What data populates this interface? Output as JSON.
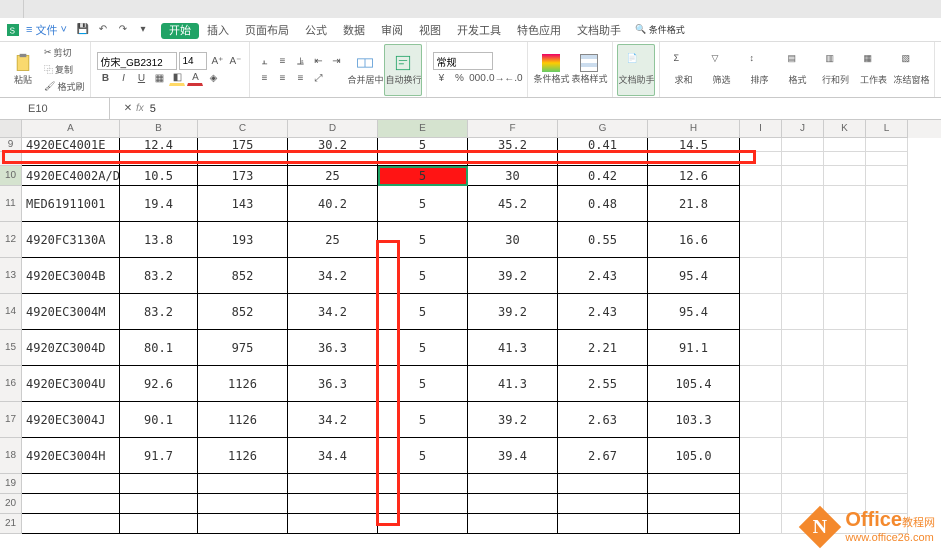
{
  "menu": {
    "file": "文件",
    "tabs": [
      "开始",
      "插入",
      "页面布局",
      "公式",
      "数据",
      "审阅",
      "视图",
      "开发工具",
      "特色应用",
      "文档助手"
    ],
    "active_index": 0,
    "cond_fmt_hint": "条件格式"
  },
  "ribbon": {
    "cut": "剪切",
    "copy": "复制",
    "fmtpaint": "格式刷",
    "paste": "粘贴",
    "font_name": "仿宋_GB2312",
    "font_size": "14",
    "merge": "合并居中",
    "autowrap": "自动换行",
    "num_fmt": "常规",
    "cond_fmt": "条件格式",
    "tbl_style": "表格样式",
    "doc_helper": "文档助手",
    "sum": "求和",
    "filter": "筛选",
    "sort": "排序",
    "format": "格式",
    "rowcol": "行和列",
    "sheet": "工作表",
    "freeze": "冻结窗格"
  },
  "name_box": "E10",
  "formula": {
    "fx": "fx",
    "value": "5"
  },
  "columns": [
    "A",
    "B",
    "C",
    "D",
    "E",
    "F",
    "G",
    "H",
    "I",
    "J",
    "K",
    "L"
  ],
  "sel_col_index": 4,
  "rows_data": [
    {
      "n": "9",
      "h": "short",
      "d": [
        "4920EC4001E",
        "12.4",
        "175",
        "30.2",
        "5",
        "35.2",
        "0.41",
        "14.5"
      ]
    },
    {
      "n": "",
      "h": "short",
      "d": [
        "",
        "",
        "",
        "",
        "",
        "",
        "",
        ""
      ]
    },
    {
      "n": "10",
      "h": "med",
      "d": [
        "4920EC4002A/D",
        "10.5",
        "173",
        "25",
        "5",
        "30",
        "0.42",
        "12.6"
      ],
      "sel": true
    },
    {
      "n": "11",
      "h": "",
      "d": [
        "MED61911001",
        "19.4",
        "143",
        "40.2",
        "5",
        "45.2",
        "0.48",
        "21.8"
      ]
    },
    {
      "n": "12",
      "h": "",
      "d": [
        "4920FC3130A",
        "13.8",
        "193",
        "25",
        "5",
        "30",
        "0.55",
        "16.6"
      ]
    },
    {
      "n": "13",
      "h": "",
      "d": [
        "4920EC3004B",
        "83.2",
        "852",
        "34.2",
        "5",
        "39.2",
        "2.43",
        "95.4"
      ]
    },
    {
      "n": "14",
      "h": "",
      "d": [
        "4920EC3004M",
        "83.2",
        "852",
        "34.2",
        "5",
        "39.2",
        "2.43",
        "95.4"
      ]
    },
    {
      "n": "15",
      "h": "",
      "d": [
        "4920ZC3004D",
        "80.1",
        "975",
        "36.3",
        "5",
        "41.3",
        "2.21",
        "91.1"
      ]
    },
    {
      "n": "16",
      "h": "",
      "d": [
        "4920EC3004U",
        "92.6",
        "1126",
        "36.3",
        "5",
        "41.3",
        "2.55",
        "105.4"
      ]
    },
    {
      "n": "17",
      "h": "",
      "d": [
        "4920EC3004J",
        "90.1",
        "1126",
        "34.2",
        "5",
        "39.2",
        "2.63",
        "103.3"
      ]
    },
    {
      "n": "18",
      "h": "",
      "d": [
        "4920EC3004H",
        "91.7",
        "1126",
        "34.4",
        "5",
        "39.4",
        "2.67",
        "105.0"
      ]
    },
    {
      "n": "19",
      "h": "med",
      "d": [
        "",
        "",
        "",
        "",
        "",
        "",
        "",
        ""
      ]
    },
    {
      "n": "20",
      "h": "med",
      "d": [
        "",
        "",
        "",
        "",
        "",
        "",
        "",
        ""
      ]
    },
    {
      "n": "21",
      "h": "med",
      "d": [
        "",
        "",
        "",
        "",
        "",
        "",
        "",
        ""
      ]
    }
  ],
  "watermark": {
    "brand": "Office",
    "sub": "教程网",
    "url": "www.office26.com"
  }
}
